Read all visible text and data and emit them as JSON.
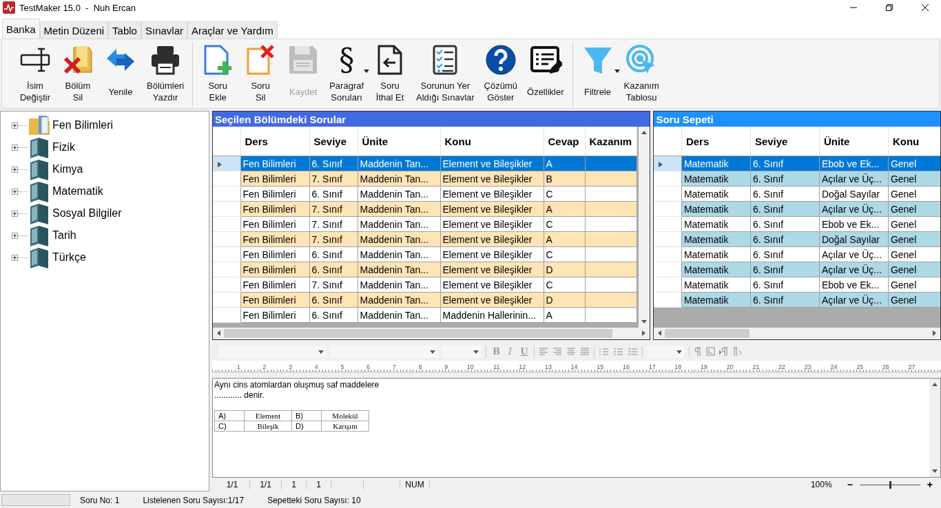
{
  "window": {
    "title": "TestMaker 15.0  -  Nuh Ercan"
  },
  "tabs": [
    {
      "label": "Banka",
      "selected": true
    },
    {
      "label": "Metin Düzeni",
      "selected": false
    },
    {
      "label": "Tablo",
      "selected": false
    },
    {
      "label": "Sınavlar",
      "selected": false
    },
    {
      "label": "Araçlar ve Yardım",
      "selected": false
    }
  ],
  "ribbon": {
    "groups": [
      [
        {
          "label": "İsim\nDeğiştir",
          "disabled": false,
          "dropdown": false
        },
        {
          "label": "Bölüm\nSil",
          "disabled": false,
          "dropdown": false
        },
        {
          "label": "Yenile",
          "disabled": false,
          "dropdown": false
        },
        {
          "label": "Bölümleri\nYazdır",
          "disabled": false,
          "dropdown": false
        }
      ],
      [
        {
          "label": "Soru\nEkle",
          "disabled": false,
          "dropdown": false
        },
        {
          "label": "Soru\nSil",
          "disabled": false,
          "dropdown": false
        },
        {
          "label": "Kaydet",
          "disabled": true,
          "dropdown": false
        },
        {
          "label": "Paragraf\nSoruları",
          "glyph": "§",
          "disabled": false,
          "dropdown": true
        },
        {
          "label": "Soru\nİthal Et",
          "disabled": false,
          "dropdown": false
        },
        {
          "label": "Sorunun Yer\nAldığı Sınavlar",
          "disabled": false,
          "dropdown": false
        },
        {
          "label": "Çözümü\nGöster",
          "disabled": false,
          "dropdown": false
        },
        {
          "label": "Özellikler",
          "disabled": false,
          "dropdown": false
        }
      ],
      [
        {
          "label": "Filtrele",
          "disabled": false,
          "dropdown": true
        },
        {
          "label": "Kazanım\nTablosu",
          "disabled": false,
          "dropdown": false
        }
      ]
    ]
  },
  "tree": {
    "items": [
      {
        "label": "Fen Bilimleri",
        "kind": "folder",
        "expanded": false
      },
      {
        "label": "Fizik",
        "kind": "book",
        "expanded": false
      },
      {
        "label": "Kimya",
        "kind": "book",
        "expanded": false
      },
      {
        "label": "Matematik",
        "kind": "book",
        "expanded": false
      },
      {
        "label": "Sosyal Bilgiler",
        "kind": "book",
        "expanded": false
      },
      {
        "label": "Tarih",
        "kind": "book",
        "expanded": false
      },
      {
        "label": "Türkçe",
        "kind": "book",
        "expanded": false
      }
    ]
  },
  "questions": {
    "title": "Seçilen Bölümdeki Sorular",
    "columns": [
      "Ders",
      "Seviye",
      "Ünite",
      "Konu",
      "Cevap",
      "Kazanım"
    ],
    "rows": [
      {
        "cells": [
          "Fen Bilimleri",
          "6. Sınıf",
          "Maddenin Tan...",
          "Element ve Bileşikler",
          "A"
        ],
        "selected": true
      },
      {
        "cells": [
          "Fen Bilimleri",
          "7. Sınıf",
          "Maddenin Tan...",
          "Element ve Bileşikler",
          "B"
        ],
        "selected": false
      },
      {
        "cells": [
          "Fen Bilimleri",
          "6. Sınıf",
          "Maddenin Tan...",
          "Element ve Bileşikler",
          "C"
        ],
        "selected": false
      },
      {
        "cells": [
          "Fen Bilimleri",
          "7. Sınıf",
          "Maddenin Tan...",
          "Element ve Bileşikler",
          "A"
        ],
        "selected": false
      },
      {
        "cells": [
          "Fen Bilimleri",
          "7. Sınıf",
          "Maddenin Tan...",
          "Element ve Bileşikler",
          "C"
        ],
        "selected": false
      },
      {
        "cells": [
          "Fen Bilimleri",
          "7. Sınıf",
          "Maddenin Tan...",
          "Element ve Bileşikler",
          "A"
        ],
        "selected": false
      },
      {
        "cells": [
          "Fen Bilimleri",
          "6. Sınıf",
          "Maddenin Tan...",
          "Element ve Bileşikler",
          "C"
        ],
        "selected": false
      },
      {
        "cells": [
          "Fen Bilimleri",
          "6. Sınıf",
          "Maddenin Tan...",
          "Element ve Bileşikler",
          "D"
        ],
        "selected": false
      },
      {
        "cells": [
          "Fen Bilimleri",
          "7. Sınıf",
          "Maddenin Tan...",
          "Element ve Bileşikler",
          "C"
        ],
        "selected": false
      },
      {
        "cells": [
          "Fen Bilimleri",
          "6. Sınıf",
          "Maddenin Tan...",
          "Element ve Bileşikler",
          "D"
        ],
        "selected": false
      },
      {
        "cells": [
          "Fen Bilimleri",
          "6. Sınıf",
          "Maddenin Tan...",
          "Maddenin Hallerinin...",
          "A"
        ],
        "selected": false
      }
    ]
  },
  "basket": {
    "title": "Soru Sepeti",
    "columns": [
      "Ders",
      "Seviye",
      "Ünite",
      "Konu"
    ],
    "rows": [
      {
        "cells": [
          "Matematik",
          "6. Sınıf",
          "Ebob ve Ek...",
          "Genel"
        ],
        "selected": true
      },
      {
        "cells": [
          "Matematik",
          "6. Sınıf",
          "Açılar ve Üç...",
          "Genel"
        ],
        "selected": false
      },
      {
        "cells": [
          "Matematik",
          "6. Sınıf",
          "Doğal Sayılar",
          "Genel"
        ],
        "selected": false
      },
      {
        "cells": [
          "Matematik",
          "6. Sınıf",
          "Açılar ve Üç...",
          "Genel"
        ],
        "selected": false
      },
      {
        "cells": [
          "Matematik",
          "6. Sınıf",
          "Ebob ve Ek...",
          "Genel"
        ],
        "selected": false
      },
      {
        "cells": [
          "Matematik",
          "6. Sınıf",
          "Doğal Sayılar",
          "Genel"
        ],
        "selected": false
      },
      {
        "cells": [
          "Matematik",
          "6. Sınıf",
          "Açılar ve Üç...",
          "Genel"
        ],
        "selected": false
      },
      {
        "cells": [
          "Matematik",
          "6. Sınıf",
          "Açılar ve Üç...",
          "Genel"
        ],
        "selected": false
      },
      {
        "cells": [
          "Matematik",
          "6. Sınıf",
          "Ebob ve Ek...",
          "Genel"
        ],
        "selected": false
      },
      {
        "cells": [
          "Matematik",
          "6. Sınıf",
          "Açılar ve Üç...",
          "Genel"
        ],
        "selected": false
      }
    ]
  },
  "editor": {
    "format_buttons": [
      "B",
      "I",
      "U"
    ],
    "ruler": [
      "1",
      "2",
      "3",
      "4",
      "5",
      "6",
      "7",
      "8",
      "9",
      "10",
      "11",
      "12",
      "13",
      "14",
      "15",
      "16",
      "17",
      "18",
      "19",
      "20",
      "21",
      "22",
      "23",
      "24",
      "25",
      "26",
      "27"
    ],
    "question_lines": [
      "Aynı cins atomlardan oluşmuş saf maddelere",
      "............ denir."
    ],
    "options": [
      {
        "letter": "A)",
        "text": "Element"
      },
      {
        "letter": "B)",
        "text": "Molekül"
      },
      {
        "letter": "C)",
        "text": "Bileşik"
      },
      {
        "letter": "D)",
        "text": "Karışım"
      }
    ],
    "status_cells": [
      "1/1",
      "1/1",
      "1",
      "1",
      "NUM"
    ],
    "zoom": {
      "reading": "100%",
      "minus": "−",
      "plus": "+",
      "level": 0.5
    }
  },
  "status_bar": {
    "items": [
      "Soru No: 1",
      "Listelenen Soru Sayısı:1/17",
      "Sepetteki Soru Sayısı: 10"
    ]
  }
}
